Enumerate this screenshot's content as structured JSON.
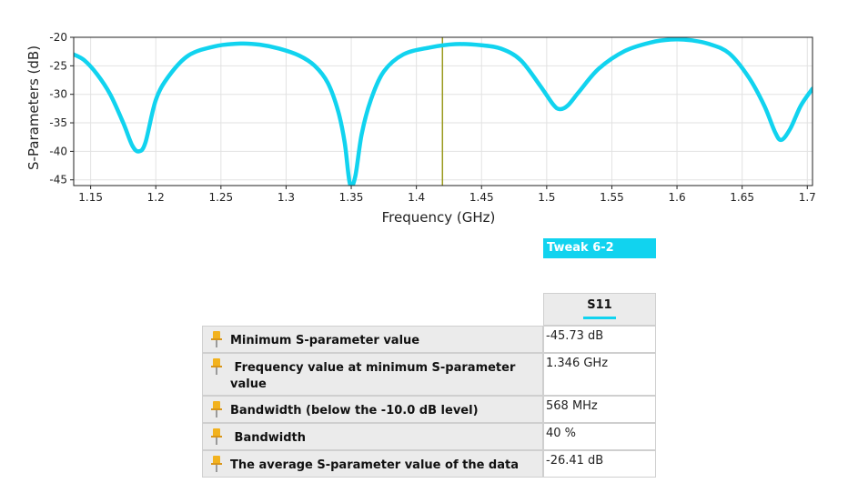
{
  "chart_data": {
    "type": "line",
    "xlabel": "Frequency (GHz)",
    "ylabel": "S-Parameters (dB)",
    "xlim": [
      1.137,
      1.704
    ],
    "ylim": [
      -46,
      -20
    ],
    "xticks": [
      1.15,
      1.2,
      1.25,
      1.3,
      1.35,
      1.4,
      1.45,
      1.5,
      1.55,
      1.6,
      1.65,
      1.7
    ],
    "xtick_labels": [
      "1.15",
      "1.2",
      "1.25",
      "1.3",
      "1.35",
      "1.4",
      "1.45",
      "1.5",
      "1.55",
      "1.6",
      "1.65",
      "1.7"
    ],
    "yticks": [
      -20,
      -25,
      -30,
      -35,
      -40,
      -45
    ],
    "ytick_labels": [
      "-20",
      "-25",
      "-30",
      "-35",
      "-40",
      "-45"
    ],
    "grid": true,
    "marker_x": 1.42,
    "series": [
      {
        "name": "Tweak 6-2",
        "color": "#11d3ef",
        "x": [
          1.137,
          1.145,
          1.155,
          1.165,
          1.175,
          1.182,
          1.187,
          1.192,
          1.2,
          1.21,
          1.225,
          1.245,
          1.265,
          1.28,
          1.295,
          1.31,
          1.322,
          1.332,
          1.34,
          1.345,
          1.349,
          1.353,
          1.358,
          1.365,
          1.375,
          1.39,
          1.41,
          1.43,
          1.45,
          1.465,
          1.48,
          1.495,
          1.505,
          1.51,
          1.516,
          1.525,
          1.54,
          1.56,
          1.58,
          1.595,
          1.61,
          1.625,
          1.64,
          1.655,
          1.667,
          1.675,
          1.68,
          1.687,
          1.695,
          1.704
        ],
        "y": [
          -23.0,
          -24.0,
          -26.5,
          -30.0,
          -35.0,
          -39.0,
          -40.0,
          -38.5,
          -31.0,
          -26.8,
          -23.2,
          -21.6,
          -21.1,
          -21.3,
          -22.0,
          -23.2,
          -25.0,
          -28.0,
          -33.0,
          -38.5,
          -45.7,
          -44.5,
          -37.0,
          -31.0,
          -26.0,
          -23.0,
          -21.8,
          -21.2,
          -21.4,
          -22.0,
          -24.0,
          -28.5,
          -31.8,
          -32.6,
          -32.0,
          -29.5,
          -25.5,
          -22.4,
          -20.9,
          -20.4,
          -20.5,
          -21.2,
          -22.8,
          -27.0,
          -32.0,
          -36.5,
          -38.0,
          -36.0,
          -32.0,
          -29.0
        ]
      }
    ]
  },
  "legend": {
    "label": "Tweak 6-2"
  },
  "table": {
    "column_header": "S11",
    "rows": [
      {
        "label": "Minimum S-parameter value",
        "value": "-45.73 dB"
      },
      {
        "label": " Frequency value at minimum S-parameter value",
        "value": "1.346 GHz"
      },
      {
        "label": "Bandwidth (below the -10.0 dB level)",
        "value": "568 MHz"
      },
      {
        "label": " Bandwidth",
        "value": "40 %"
      },
      {
        "label": "The average S-parameter value of the data",
        "value": "-26.41 dB"
      }
    ]
  },
  "colors": {
    "accent": "#11d3ef",
    "marker": "#9a9a1e",
    "pin": "#f2b21e"
  }
}
